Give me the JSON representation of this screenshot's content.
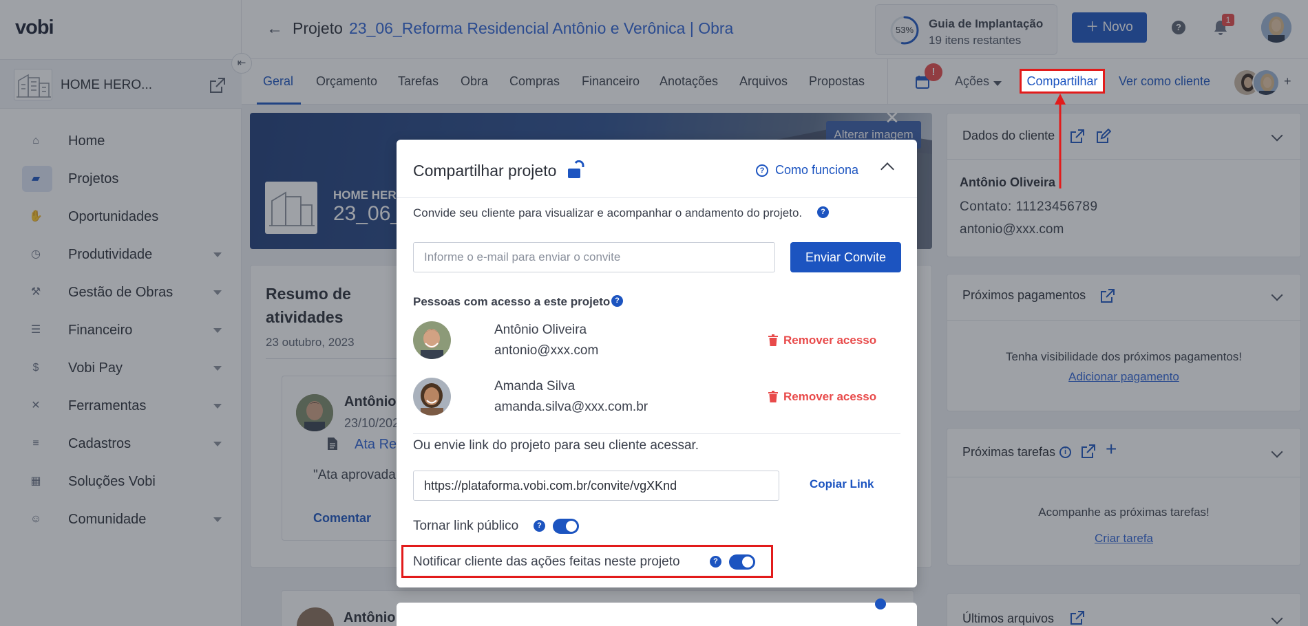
{
  "app": {
    "logo": "vobi"
  },
  "sidebar": {
    "company_name": "HOME HERO...",
    "items": [
      {
        "label": "Home",
        "icon": "home-icon",
        "glyph": "⌂"
      },
      {
        "label": "Projetos",
        "icon": "folder-icon",
        "glyph": "▰"
      },
      {
        "label": "Oportunidades",
        "icon": "handshake-icon",
        "glyph": "✋"
      },
      {
        "label": "Produtividade",
        "icon": "clock-icon",
        "glyph": "◷"
      },
      {
        "label": "Gestão de Obras",
        "icon": "worker-icon",
        "glyph": "⚒"
      },
      {
        "label": "Financeiro",
        "icon": "coins-icon",
        "glyph": "☰"
      },
      {
        "label": "Vobi Pay",
        "icon": "dollar-icon",
        "glyph": "$"
      },
      {
        "label": "Ferramentas",
        "icon": "tools-icon",
        "glyph": "✕"
      },
      {
        "label": "Cadastros",
        "icon": "list-icon",
        "glyph": "≡"
      },
      {
        "label": "Soluções Vobi",
        "icon": "apps-icon",
        "glyph": "▦"
      },
      {
        "label": "Comunidade",
        "icon": "people-icon",
        "glyph": "☺"
      }
    ]
  },
  "header": {
    "project_prefix": "Projeto",
    "project_name": "23_06_Reforma Residencial Antônio e Verônica | Obra",
    "guide": {
      "percent": "53%",
      "title": "Guia de Implantação",
      "subtitle": "19 itens restantes",
      "progress": 0.53
    },
    "new_label": "Novo",
    "notifications_count": "1"
  },
  "tabs": [
    "Geral",
    "Orçamento",
    "Tarefas",
    "Obra",
    "Compras",
    "Financeiro",
    "Anotações",
    "Arquivos",
    "Propostas"
  ],
  "tab_actions": {
    "calendar_badge": "!",
    "actions_label": "Ações",
    "share_label": "Compartilhar",
    "client_view_label": "Ver como cliente"
  },
  "banner": {
    "title": "HOME HERO",
    "subtitle": "23_06_",
    "change_image_label": "Alterar imagem"
  },
  "summary": {
    "title": "Resumo de atividades",
    "date": "23 outubro, 2023",
    "activity": {
      "author": "Antônio",
      "date": "23/10/202",
      "doc": "Ata Reu",
      "quote": "\"Ata aprovada",
      "comment_label": "Comentar"
    },
    "second_author": "Antônio"
  },
  "right_panel": {
    "client_card": {
      "title": "Dados do cliente",
      "name": "Antônio Oliveira",
      "contact": "Contato: 11123456789",
      "email": "antonio@xxx.com"
    },
    "payments_card": {
      "title": "Próximos pagamentos",
      "empty_text": "Tenha visibilidade dos próximos pagamentos!",
      "action": "Adicionar pagamento"
    },
    "tasks_card": {
      "title": "Próximas tarefas",
      "empty_text": "Acompanhe as próximas tarefas!",
      "action": "Criar tarefa"
    },
    "files_card": {
      "title": "Últimos arquivos"
    }
  },
  "modal": {
    "title": "Compartilhar projeto",
    "how_it_works": "Como funciona",
    "invite_description": "Convide seu cliente para visualizar e acompanhar o andamento do projeto.",
    "email_placeholder": "Informe o e-mail para enviar o convite",
    "send_label": "Enviar Convite",
    "people_title": "Pessoas com acesso a este projeto",
    "people": [
      {
        "name": "Antônio Oliveira",
        "email": "antonio@xxx.com",
        "remove_label": "Remover acesso"
      },
      {
        "name": "Amanda Silva",
        "email": "amanda.silva@xxx.com.br",
        "remove_label": "Remover acesso"
      }
    ],
    "link_description": "Ou envie link do projeto para seu cliente acessar.",
    "link_value": "https://plataforma.vobi.com.br/convite/vgXKnd",
    "copy_label": "Copiar Link",
    "public_link_label": "Tornar link público",
    "public_link_on": true,
    "notify_label": "Notificar cliente das ações feitas neste projeto",
    "notify_on": true
  },
  "colors": {
    "primary": "#1c54c0",
    "danger": "#e84a4a",
    "highlight": "#e21b1b"
  }
}
